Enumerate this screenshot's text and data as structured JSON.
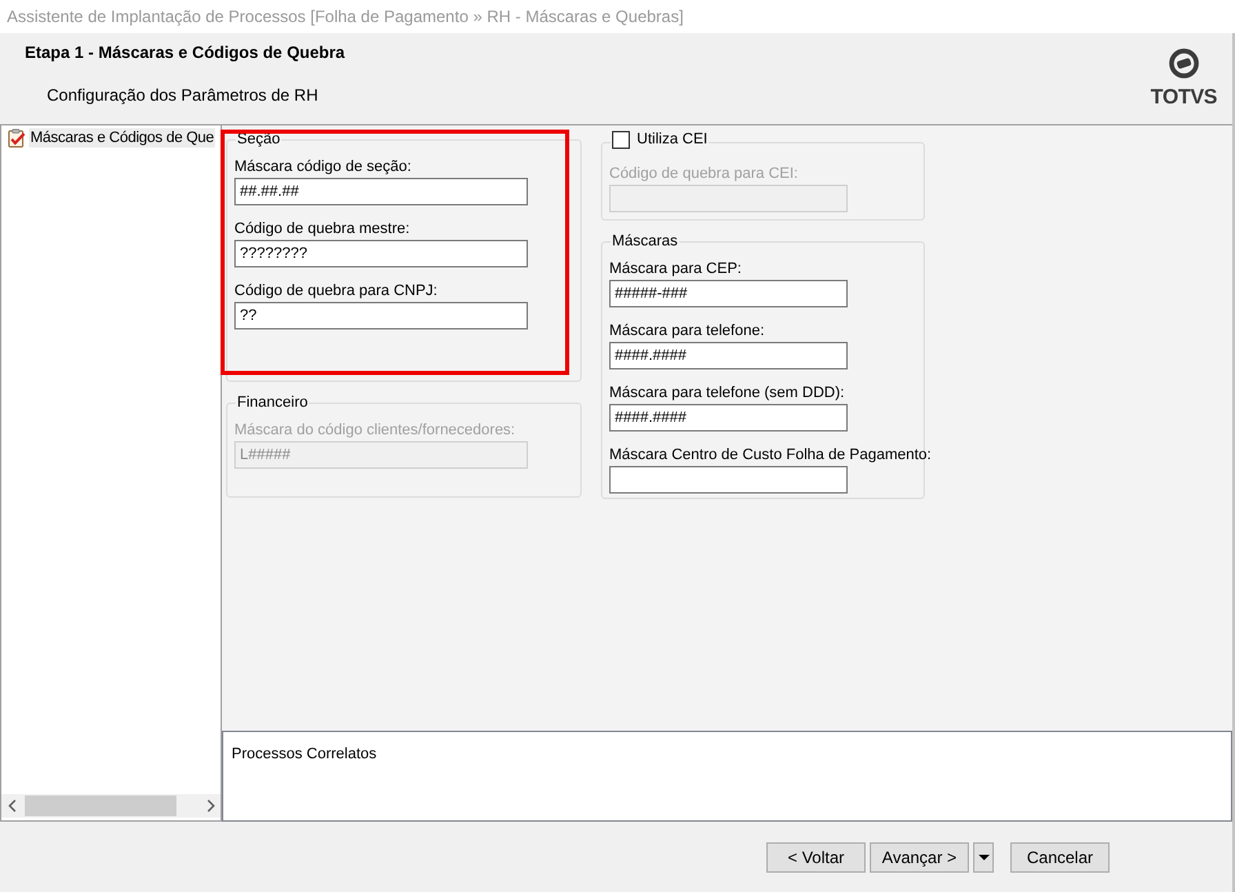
{
  "window": {
    "title": "Assistente de Implantação de Processos [Folha de Pagamento » RH - Máscaras e Quebras]"
  },
  "header": {
    "title": "Etapa 1 - Máscaras e Códigos de Quebra",
    "subtitle": "Configuração dos Parâmetros de RH",
    "logo": {
      "text": "TOTVS"
    }
  },
  "tree": {
    "items": [
      {
        "label": "Máscaras e Códigos de Que",
        "selected": true
      }
    ]
  },
  "columns": [
    {
      "groups": [
        {
          "kind": "plain",
          "title": "Seção",
          "highlighted": true,
          "fields": [
            {
              "label": "Máscara código de seção:",
              "value": "##.##.##",
              "disabled": false
            },
            {
              "label": "Código de quebra mestre:",
              "value": "????????",
              "disabled": false
            },
            {
              "label": "Código de quebra para CNPJ:",
              "value": "??",
              "disabled": false
            }
          ]
        },
        {
          "kind": "plain",
          "title": "Financeiro",
          "highlighted": false,
          "fields": [
            {
              "label": "Máscara do código clientes/fornecedores:",
              "value": "L#####",
              "disabled": true
            }
          ]
        }
      ]
    },
    {
      "groups": [
        {
          "kind": "checkbox",
          "title": "Utiliza CEI",
          "checked": false,
          "highlighted": false,
          "fields": [
            {
              "label": "Código de quebra para CEI:",
              "disabled": true
            }
          ]
        },
        {
          "kind": "plain",
          "title": "Máscaras",
          "highlighted": false,
          "fields": [
            {
              "label": "Máscara para CEP:",
              "value": "#####-###",
              "disabled": false
            },
            {
              "label": "Máscara para telefone:",
              "value": "####.####",
              "disabled": false
            },
            {
              "label": "Máscara para telefone (sem DDD):",
              "value": "####.####",
              "disabled": false
            },
            {
              "label": "Máscara Centro de Custo Folha de Pagamento:",
              "disabled": false
            }
          ]
        }
      ]
    }
  ],
  "related_panel": {
    "title": "Processos Correlatos"
  },
  "buttons": [
    {
      "kind": "button",
      "label": "< Voltar"
    },
    {
      "kind": "button",
      "label": "Avançar >"
    },
    {
      "kind": "dropdown"
    },
    {
      "kind": "button",
      "label": "Cancelar"
    }
  ]
}
